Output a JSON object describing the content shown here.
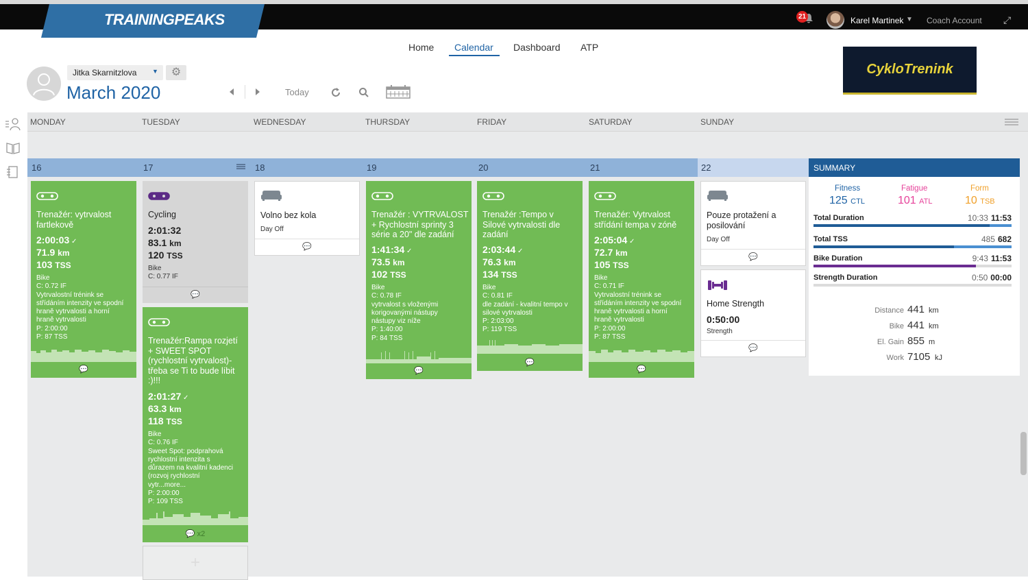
{
  "app": {
    "logo": "TRAININGPEAKS",
    "notifications": "21",
    "user_name": "Karel Martinek",
    "coach_label": "Coach Account"
  },
  "nav": {
    "home": "Home",
    "calendar": "Calendar",
    "dashboard": "Dashboard",
    "atp": "ATP"
  },
  "athlete": {
    "name": "Jitka Skarnitzlova",
    "month": "March 2020"
  },
  "toolbar": {
    "today": "Today"
  },
  "brand": "CykloTrenink",
  "days": [
    "MONDAY",
    "TUESDAY",
    "WEDNESDAY",
    "THURSDAY",
    "FRIDAY",
    "SATURDAY",
    "SUNDAY"
  ],
  "dates": [
    "16",
    "17",
    "18",
    "19",
    "20",
    "21",
    "22"
  ],
  "cards": {
    "mon": {
      "title": [
        "Trenažér: vytrvalost",
        "fartlekově"
      ],
      "duration": "2:00:03",
      "distance": "71.9",
      "dist_unit": "km",
      "tss": "103",
      "tss_unit": "TSS",
      "details": [
        "Bike",
        "C: 0.72 IF",
        "Vytrvalostní trénink se",
        "střídáním intenzity ve spodní",
        "hraně vytrvalosti a horní",
        "hraně vytrvalosti",
        "P: 2:00:00",
        "P: 87 TSS"
      ]
    },
    "tue1": {
      "title": [
        "Cycling"
      ],
      "duration": "2:01:32",
      "distance": "83.1",
      "dist_unit": "km",
      "tss": "120",
      "tss_unit": "TSS",
      "details": [
        "Bike",
        "C: 0.77 IF"
      ]
    },
    "tue2": {
      "title": [
        "Trenažér:Rampa rozjetí",
        "+ SWEET SPOT",
        "(rychlostní vytrvalost)-",
        "třeba se Ti to bude líbit",
        ":)!!!"
      ],
      "duration": "2:01:27",
      "distance": "63.3",
      "dist_unit": "km",
      "tss": "118",
      "tss_unit": "TSS",
      "details": [
        "Bike",
        "C: 0.76 IF",
        "Sweet Spot: podprahová",
        "rychlostní intenzita s",
        "důrazem na kvalitní kadenci",
        "(rozvoj rychlostní",
        "vytr...more...",
        "P: 2:00:00",
        "P: 109 TSS"
      ],
      "comments": "x2"
    },
    "wed": {
      "title": [
        "Volno bez kola"
      ],
      "sub": "Day Off"
    },
    "thu": {
      "title": [
        "Trenažér : VYTRVALOST",
        "+ Rychlostní sprinty 3",
        "série a 20\" dle zadání"
      ],
      "duration": "1:41:34",
      "distance": "73.5",
      "dist_unit": "km",
      "tss": "102",
      "tss_unit": "TSS",
      "details": [
        "Bike",
        "C: 0.78 IF",
        "vytrvalost s vloženými",
        "korigovanými nástupy",
        "nástupy viz níže",
        "P: 1:40:00",
        "P: 84 TSS"
      ]
    },
    "fri": {
      "title": [
        "Trenažér :Tempo v",
        "Silové vytrvalosti dle",
        "zadání"
      ],
      "duration": "2:03:44",
      "distance": "76.3",
      "dist_unit": "km",
      "tss": "134",
      "tss_unit": "TSS",
      "details": [
        "Bike",
        "C: 0.81 IF",
        "dle zadání - kvalitní tempo v",
        "silové vytrvalosti",
        "P: 2:03:00",
        "P: 119 TSS"
      ]
    },
    "sat": {
      "title": [
        "Trenažér: Vytrvalost",
        "střídání tempa v zóně"
      ],
      "duration": "2:05:04",
      "distance": "72.7",
      "dist_unit": "km",
      "tss": "105",
      "tss_unit": "TSS",
      "details": [
        "Bike",
        "C: 0.71 IF",
        "Vytrvalostní trénink se",
        "střídáním intenzity ve spodní",
        "hraně vytrvalosti a horní",
        "hraně vytrvalosti",
        "P: 2:00:00",
        "P: 87 TSS"
      ]
    },
    "sun1": {
      "title": [
        "Pouze protažení a",
        "posilování"
      ],
      "sub": "Day Off"
    },
    "sun2": {
      "title": [
        "Home Strength"
      ],
      "duration": "0:50:00",
      "sub": "Strength"
    }
  },
  "summary": {
    "heading": "SUMMARY",
    "fitness": {
      "label": "Fitness",
      "value": "125",
      "unit": "CTL"
    },
    "fatigue": {
      "label": "Fatigue",
      "value": "101",
      "unit": "ATL"
    },
    "form": {
      "label": "Form",
      "value": "10",
      "unit": "TSB"
    },
    "rows": [
      {
        "label": "Total Duration",
        "done": "10:33",
        "planned": "11:53",
        "fraction": 0.89,
        "color": "#1f5c96"
      },
      {
        "label": "Total TSS",
        "done": "485",
        "planned": "682",
        "fraction": 0.71,
        "color": "#1f5c96"
      },
      {
        "label": "Bike Duration",
        "done": "9:43",
        "planned": "11:53",
        "fraction": 0.82,
        "color": "#6a2c91"
      },
      {
        "label": "Strength Duration",
        "done": "0:50",
        "planned": "00:00",
        "fraction": 1.0,
        "color": "#dcdcdc"
      }
    ],
    "stats": [
      {
        "label": "Distance",
        "value": "441",
        "unit": "km"
      },
      {
        "label": "Bike",
        "value": "441",
        "unit": "km"
      },
      {
        "label": "El. Gain",
        "value": "855",
        "unit": "m"
      },
      {
        "label": "Work",
        "value": "7105",
        "unit": "kJ"
      }
    ],
    "colors": {
      "fitness": "#1f63a5",
      "fatigue": "#e6429a",
      "form": "#f0a02a"
    }
  }
}
